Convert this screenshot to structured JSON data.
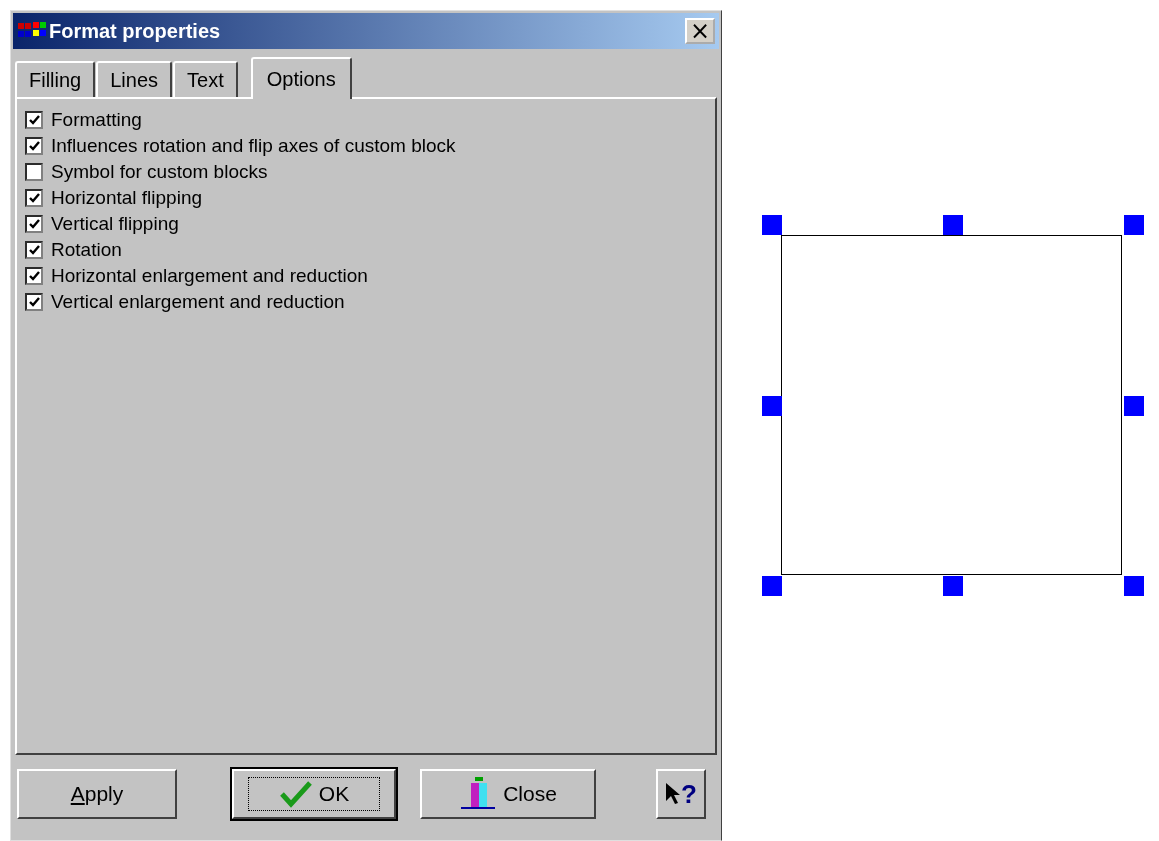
{
  "window": {
    "title": "Format properties",
    "close": "×"
  },
  "tabs": [
    {
      "label": "Filling",
      "selected": false
    },
    {
      "label": "Lines",
      "selected": false
    },
    {
      "label": "Text",
      "selected": false
    },
    {
      "label": "Options",
      "selected": true
    }
  ],
  "options": [
    {
      "label": "Formatting",
      "checked": true
    },
    {
      "label": "Influences rotation and flip axes of custom block",
      "checked": true
    },
    {
      "label": "Symbol for custom blocks",
      "checked": false
    },
    {
      "label": "Horizontal flipping",
      "checked": true
    },
    {
      "label": "Vertical flipping",
      "checked": true
    },
    {
      "label": "Rotation",
      "checked": true
    },
    {
      "label": "Horizontal enlargement and reduction",
      "checked": true
    },
    {
      "label": "Vertical enlargement and reduction",
      "checked": true
    }
  ],
  "buttons": [
    {
      "kind": "apply",
      "label": "Apply",
      "underline_first": true
    },
    {
      "kind": "ok",
      "label": "OK"
    },
    {
      "kind": "close",
      "label": "Close"
    },
    {
      "kind": "help",
      "label": "?"
    }
  ],
  "canvas": {
    "shape": {
      "selected": true
    }
  }
}
